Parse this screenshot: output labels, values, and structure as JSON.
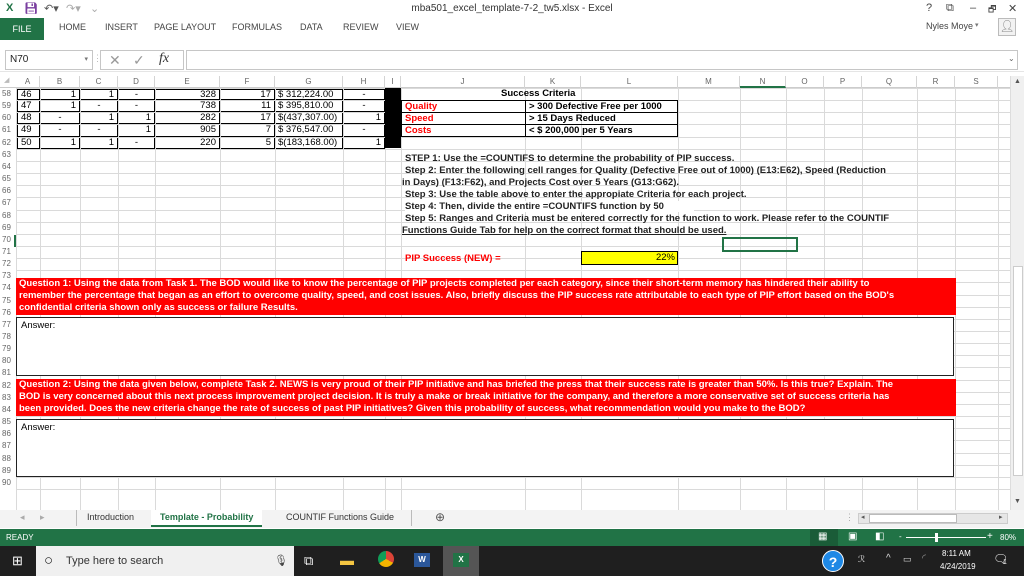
{
  "window": {
    "title": "mba501_excel_template-7-2_tw5.xlsx - Excel",
    "user": "Nyles Moye",
    "buttons": {
      "help": "?",
      "ribbon_display": "⧉",
      "minimize": "–",
      "restore": "🗗",
      "close": "✕"
    }
  },
  "ribbon": {
    "tabs": [
      "FILE",
      "HOME",
      "INSERT",
      "PAGE LAYOUT",
      "FORMULAS",
      "DATA",
      "REVIEW",
      "VIEW"
    ]
  },
  "formula_bar": {
    "name_box": "N70",
    "cancel": "✕",
    "enter": "✓",
    "fx": "fx",
    "value": ""
  },
  "columns": [
    "A",
    "B",
    "C",
    "D",
    "E",
    "F",
    "G",
    "H",
    "I",
    "J",
    "K",
    "L",
    "M",
    "N",
    "O",
    "P",
    "Q",
    "R",
    "S"
  ],
  "rows": [
    "58",
    "59",
    "60",
    "61",
    "62",
    "63",
    "64",
    "65",
    "66",
    "67",
    "68",
    "69",
    "70",
    "71",
    "72",
    "73",
    "74",
    "75",
    "76",
    "77",
    "78",
    "79",
    "80",
    "81",
    "82",
    "83",
    "84",
    "85",
    "86",
    "87",
    "88",
    "89",
    "90"
  ],
  "data_rows": [
    {
      "A": "46",
      "B": "1",
      "C": "1",
      "D": "-",
      "E": "328",
      "F": "17",
      "G": "$ 312,224.00",
      "H": "-"
    },
    {
      "A": "47",
      "B": "1",
      "C": "-",
      "D": "-",
      "E": "738",
      "F": "11",
      "G": "$ 395,810.00",
      "H": "-"
    },
    {
      "A": "48",
      "B": "-",
      "C": "1",
      "D": "1",
      "E": "282",
      "F": "17",
      "G": "$(437,307.00)",
      "H": "1"
    },
    {
      "A": "49",
      "B": "-",
      "C": "-",
      "D": "1",
      "E": "905",
      "F": "7",
      "G": "$ 376,547.00",
      "H": "-"
    },
    {
      "A": "50",
      "B": "1",
      "C": "1",
      "D": "-",
      "E": "220",
      "F": "5",
      "G": "$(183,168.00)",
      "H": "1"
    }
  ],
  "criteria": {
    "header": "Success Criteria",
    "items": [
      {
        "label": "Quality",
        "value": "> 300 Defective Free per 1000"
      },
      {
        "label": "Speed",
        "value": "> 15 Days Reduced"
      },
      {
        "label": "Costs",
        "value": "< $ 200,000 per 5 Years"
      }
    ]
  },
  "steps": {
    "s1": "STEP 1: Use the =COUNTIFS to determine the probability of PIP success.",
    "s2a": "Step 2: Enter the following cell ranges for Quality (Defective Free out of 1000) (E13:E62), Speed (Reduction",
    "s2b": "in Days) (F13:F62), and Projects Cost over 5 Years (G13:G62).",
    "s3": "Step 3: Use the table above to enter the appropiate Criteria for each project.",
    "s4": "Step 4: Then, divide the entire =COUNTIFS function by 50",
    "s5a": "Step 5: Ranges and Criteria must be entered correctly for the function to work. Please refer to the COUNTIF",
    "s5b": "Functions Guide Tab for help on the correct format that should be used."
  },
  "pip": {
    "label": "PIP Success (NEW) =",
    "value": "22%"
  },
  "q1": {
    "l1": "Question 1:  Using the data from Task 1. The BOD would like to know the percentage of PIP projects completed per each category, since their short-term memory has hindered their ability to",
    "l2": "remember the percentage that began as an effort to overcome quality, speed, and cost issues. Also, briefly discuss the PIP success rate attributable to each type of PIP effort based on the BOD's",
    "l3": "confidential criteria shown only as success or failure Results.",
    "answer": "Answer:"
  },
  "q2": {
    "l1": "Question 2:  Using the data given below, complete Task 2.  NEWS is very proud of their PIP initiative and has briefed the press that their success rate is greater than 50%. Is this true? Explain. The",
    "l2": "BOD is very concerned about this next process improvement project decision.  It is truly a make or break initiative for the company, and therefore a more conservative set of success criteria has",
    "l3": "been provided.  Does the new criteria change the rate of success of past PIP initiatives?  Given this probability of success, what recommendation would you make to the BOD?",
    "answer": "Answer:"
  },
  "sheet_tabs": [
    "Introduction",
    "Template - Probability",
    "COUNTIF Functions Guide"
  ],
  "active_sheet": "Template - Probability",
  "status": {
    "text": "READY",
    "zoom": "80%",
    "zoom_minus": "-",
    "zoom_plus": "+"
  },
  "taskbar": {
    "search_placeholder": "Type here to search",
    "time": "8:11 AM",
    "date": "4/24/2019",
    "notifications": "1"
  }
}
